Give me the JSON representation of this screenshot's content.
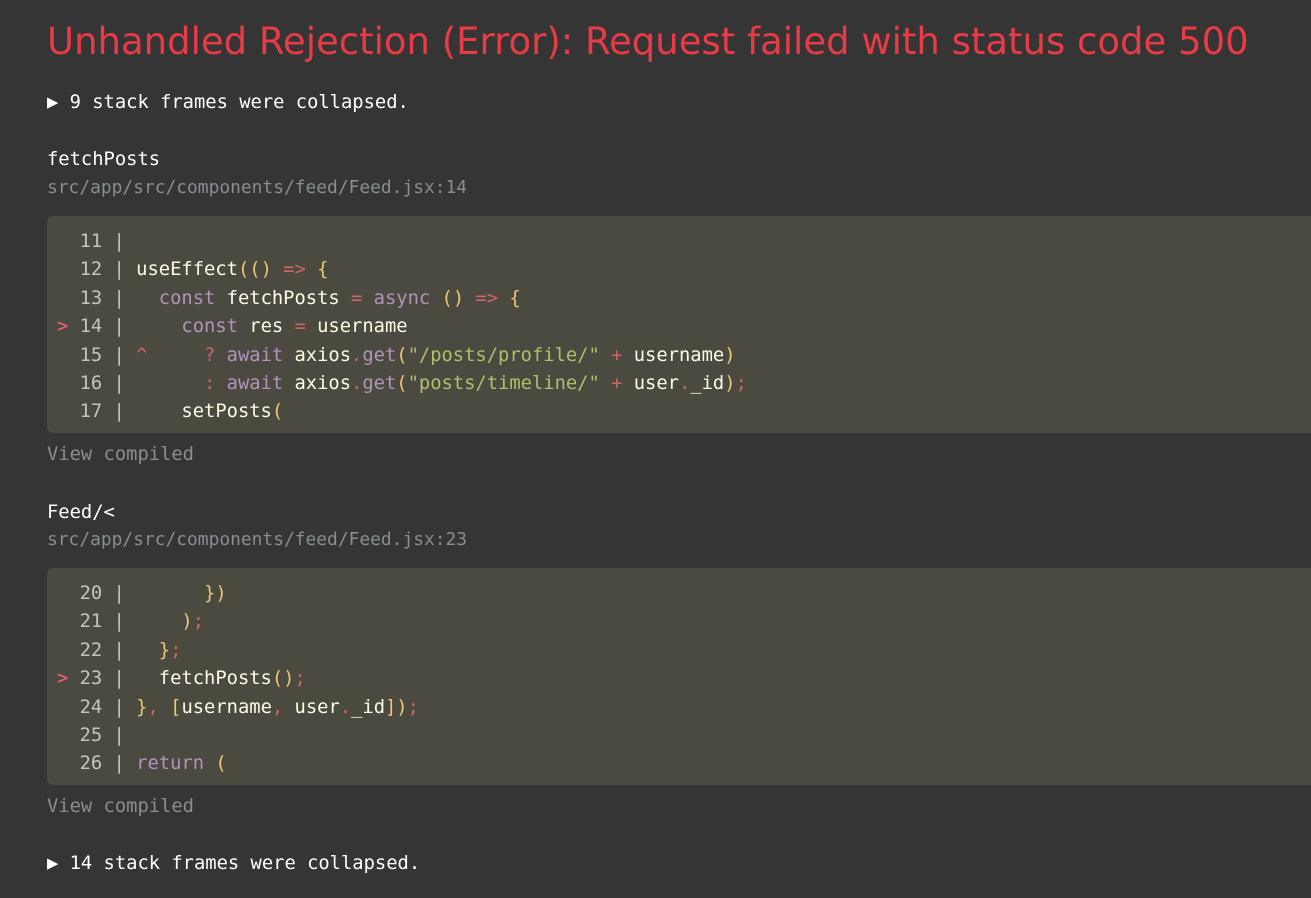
{
  "title": "Unhandled Rejection (Error): Request failed with status code 500",
  "collapsed_top": "▶ 9 stack frames were collapsed.",
  "collapsed_bottom": "▶ 14 stack frames were collapsed.",
  "colors": {
    "background": "#353535",
    "title": "#e83b46",
    "code_bg": "#4a4a41"
  },
  "frames": [
    {
      "function": "fetchPosts",
      "location": "src/app/src/components/feed/Feed.jsx:14",
      "view_compiled": "View compiled",
      "lines": [
        {
          "marker": "  ",
          "num": "11",
          "tokens": []
        },
        {
          "marker": "  ",
          "num": "12",
          "tokens": [
            [
              "id",
              " useEffect"
            ],
            [
              "br",
              "(()"
            ],
            [
              "pu",
              " =>"
            ],
            [
              "br",
              " {"
            ]
          ]
        },
        {
          "marker": "  ",
          "num": "13",
          "tokens": [
            [
              "kw",
              "   const"
            ],
            [
              "id",
              " fetchPosts"
            ],
            [
              "pu",
              " ="
            ],
            [
              "kw",
              " async"
            ],
            [
              "br",
              " ()"
            ],
            [
              "pu",
              " =>"
            ],
            [
              "br",
              " {"
            ]
          ]
        },
        {
          "marker": "> ",
          "num": "14",
          "tokens": [
            [
              "kw",
              "     const"
            ],
            [
              "id",
              " res"
            ],
            [
              "pu",
              " ="
            ],
            [
              "id",
              " username"
            ]
          ]
        },
        {
          "marker": "  ",
          "num": "15",
          "tokens": [
            [
              "car",
              " ^"
            ],
            [
              "pu",
              "     ?"
            ],
            [
              "kw",
              " await"
            ],
            [
              "id",
              " axios"
            ],
            [
              "pu",
              "."
            ],
            [
              "kw",
              "get"
            ],
            [
              "br",
              "("
            ],
            [
              "st",
              "\"/posts/profile/\""
            ],
            [
              "pu",
              " +"
            ],
            [
              "id",
              " username"
            ],
            [
              "br",
              ")"
            ]
          ]
        },
        {
          "marker": "  ",
          "num": "16",
          "tokens": [
            [
              "pu",
              "       :"
            ],
            [
              "kw",
              " await"
            ],
            [
              "id",
              " axios"
            ],
            [
              "pu",
              "."
            ],
            [
              "kw",
              "get"
            ],
            [
              "br",
              "("
            ],
            [
              "st",
              "\"posts/timeline/\""
            ],
            [
              "pu",
              " +"
            ],
            [
              "id",
              " user"
            ],
            [
              "pu",
              "."
            ],
            [
              "id",
              "_id"
            ],
            [
              "br",
              ")"
            ],
            [
              "pu",
              ";"
            ]
          ]
        },
        {
          "marker": "  ",
          "num": "17",
          "tokens": [
            [
              "id",
              "     setPosts"
            ],
            [
              "br",
              "("
            ]
          ]
        }
      ]
    },
    {
      "function": "Feed/<",
      "location": "src/app/src/components/feed/Feed.jsx:23",
      "view_compiled": "View compiled",
      "lines": [
        {
          "marker": "  ",
          "num": "20",
          "tokens": [
            [
              "br",
              "       })"
            ]
          ]
        },
        {
          "marker": "  ",
          "num": "21",
          "tokens": [
            [
              "br",
              "     )"
            ],
            [
              "pu",
              ";"
            ]
          ]
        },
        {
          "marker": "  ",
          "num": "22",
          "tokens": [
            [
              "br",
              "   }"
            ],
            [
              "pu",
              ";"
            ]
          ]
        },
        {
          "marker": "> ",
          "num": "23",
          "tokens": [
            [
              "id",
              "   fetchPosts"
            ],
            [
              "br",
              "()"
            ],
            [
              "pu",
              ";"
            ]
          ]
        },
        {
          "marker": "  ",
          "num": "24",
          "tokens": [
            [
              "br",
              " }"
            ],
            [
              "pu",
              ","
            ],
            [
              "br",
              " ["
            ],
            [
              "id",
              "username"
            ],
            [
              "pu",
              ","
            ],
            [
              "id",
              " user"
            ],
            [
              "pu",
              "."
            ],
            [
              "id",
              "_id"
            ],
            [
              "br",
              "])"
            ],
            [
              "pu",
              ";"
            ]
          ]
        },
        {
          "marker": "  ",
          "num": "25",
          "tokens": []
        },
        {
          "marker": "  ",
          "num": "26",
          "tokens": [
            [
              "kw",
              " return"
            ],
            [
              "br",
              " ("
            ]
          ]
        }
      ]
    }
  ]
}
